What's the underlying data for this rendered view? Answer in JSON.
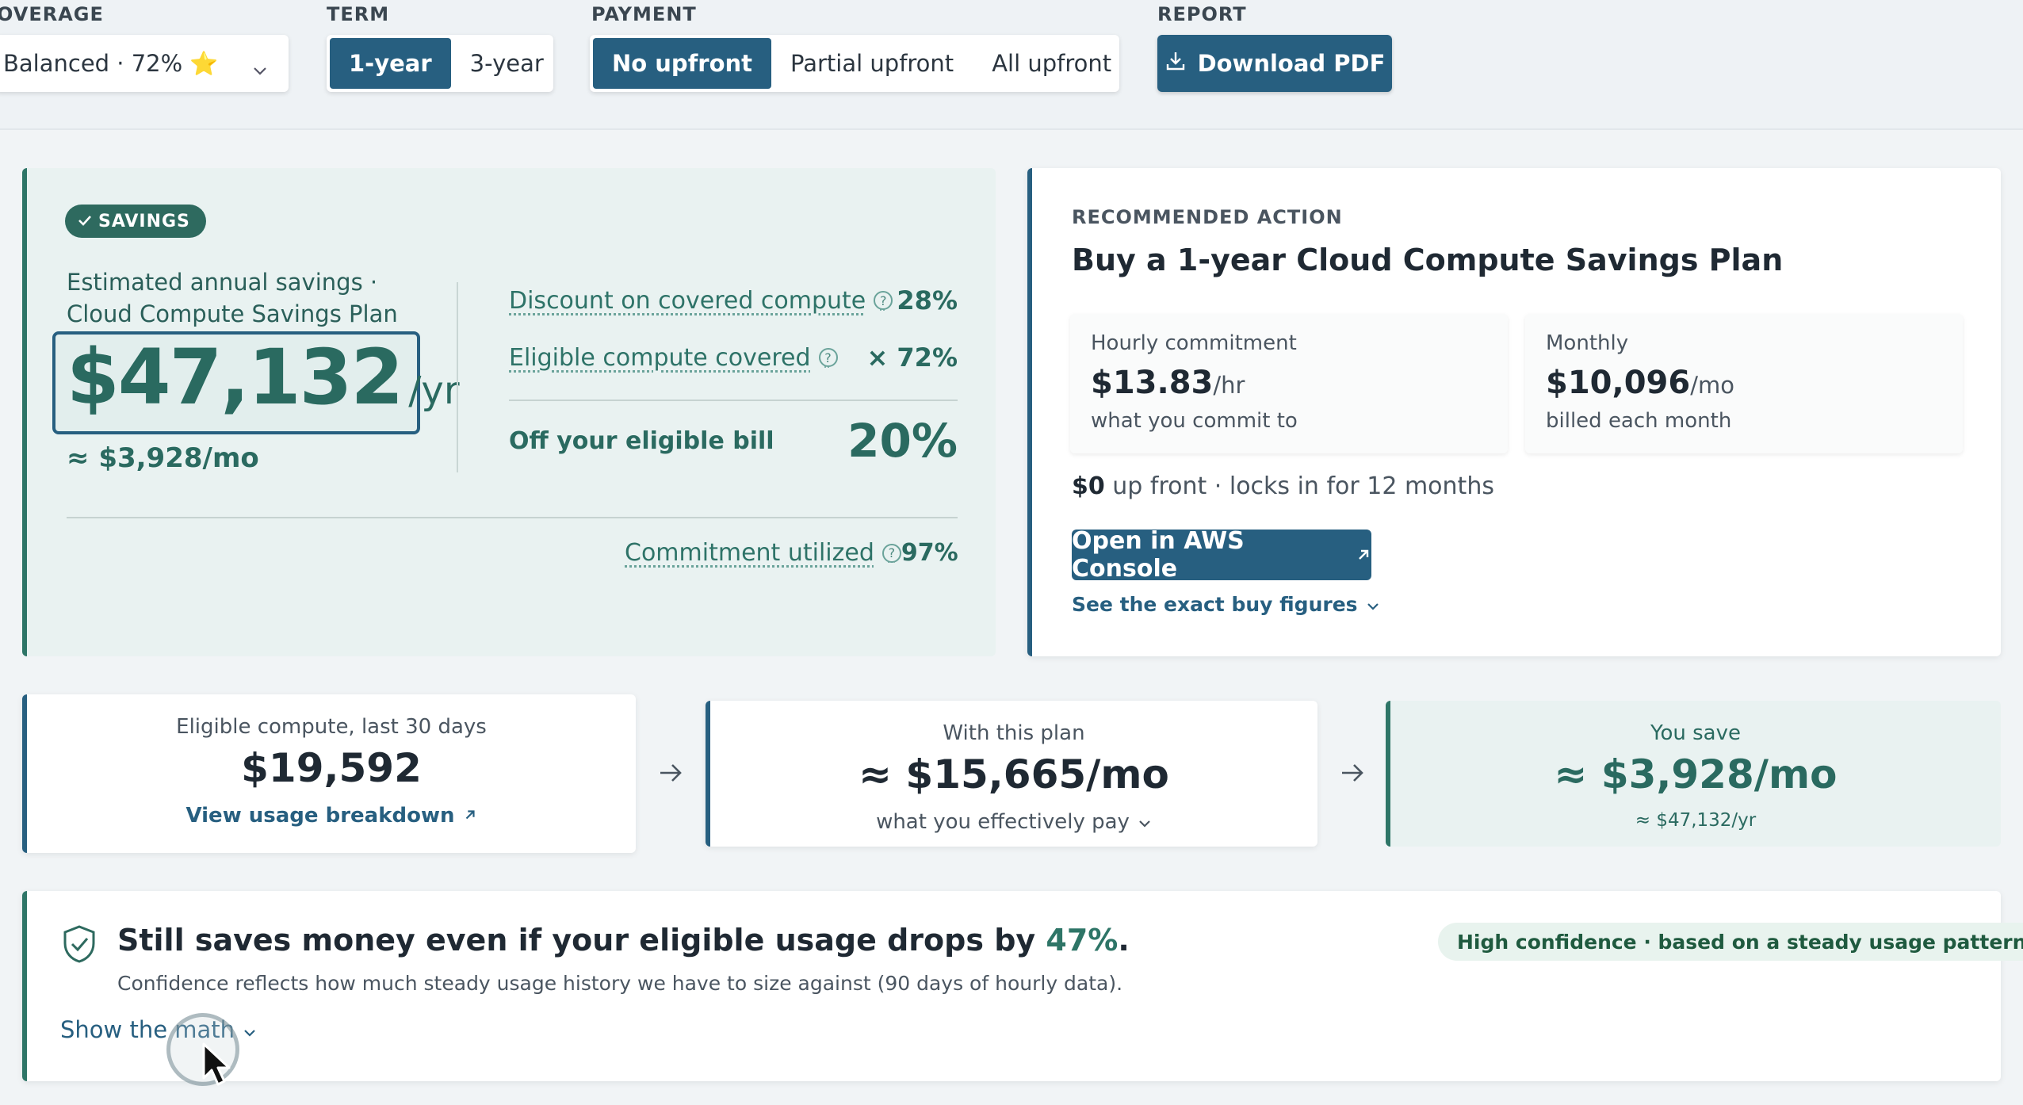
{
  "filters": {
    "coverage": {
      "label": "OVERAGE",
      "value": "Balanced · 72% ⭐"
    },
    "term": {
      "label": "TERM",
      "options": [
        "1-year",
        "3-year"
      ],
      "selected": "1-year"
    },
    "payment": {
      "label": "PAYMENT",
      "options": [
        "No upfront",
        "Partial upfront",
        "All upfront"
      ],
      "selected": "No upfront"
    },
    "report": {
      "label": "REPORT",
      "button": "Download PDF"
    }
  },
  "savings": {
    "badge": "SAVINGS",
    "label_line1": "Estimated annual savings ·",
    "label_line2": "Cloud Compute Savings Plan",
    "annual": "$47,132",
    "annual_unit": "/yr",
    "monthly": "≈ $3,928/mo",
    "metrics": [
      {
        "label": "Discount on covered compute",
        "value": "28%"
      },
      {
        "label": "Eligible compute covered",
        "value": "× 72%"
      }
    ],
    "off_label": "Off your eligible bill",
    "off_value": "20%",
    "utilized_label": "Commitment utilized",
    "utilized_value": "97%"
  },
  "recommendation": {
    "eyebrow": "RECOMMENDED ACTION",
    "title": "Buy a 1-year Cloud Compute Savings Plan",
    "hourly": {
      "title": "Hourly commitment",
      "value": "$13.83",
      "unit": "/hr",
      "sub": "what you commit to"
    },
    "monthly": {
      "title": "Monthly",
      "value": "$10,096",
      "unit": "/mo",
      "sub": "billed each month"
    },
    "upfront_amount": "$0",
    "upfront_text": " up front · locks in for 12 months",
    "console_button": "Open in AWS Console",
    "buy_figures_link": "See the exact buy figures"
  },
  "flow": {
    "eligible": {
      "title": "Eligible compute, last 30 days",
      "value": "$19,592",
      "link": "View usage breakdown"
    },
    "with_plan": {
      "title": "With this plan",
      "value": "≈ $15,665/mo",
      "sub": "what you effectively pay"
    },
    "you_save": {
      "title": "You save",
      "value": "≈ $3,928/mo",
      "sub": "≈ $47,132/yr"
    }
  },
  "confidence": {
    "title_prefix": "Still saves money even if your eligible usage drops by ",
    "title_value": "47%",
    "title_suffix": ".",
    "subtitle": "Confidence reflects how much steady usage history we have to size against (90 days of hourly data).",
    "pill": "High confidence · based on a steady usage pattern",
    "show_math": "Show the math"
  },
  "colors": {
    "primary": "#275f80",
    "savings_green": "#2a6a60",
    "savings_bg": "#e9f2f1"
  }
}
